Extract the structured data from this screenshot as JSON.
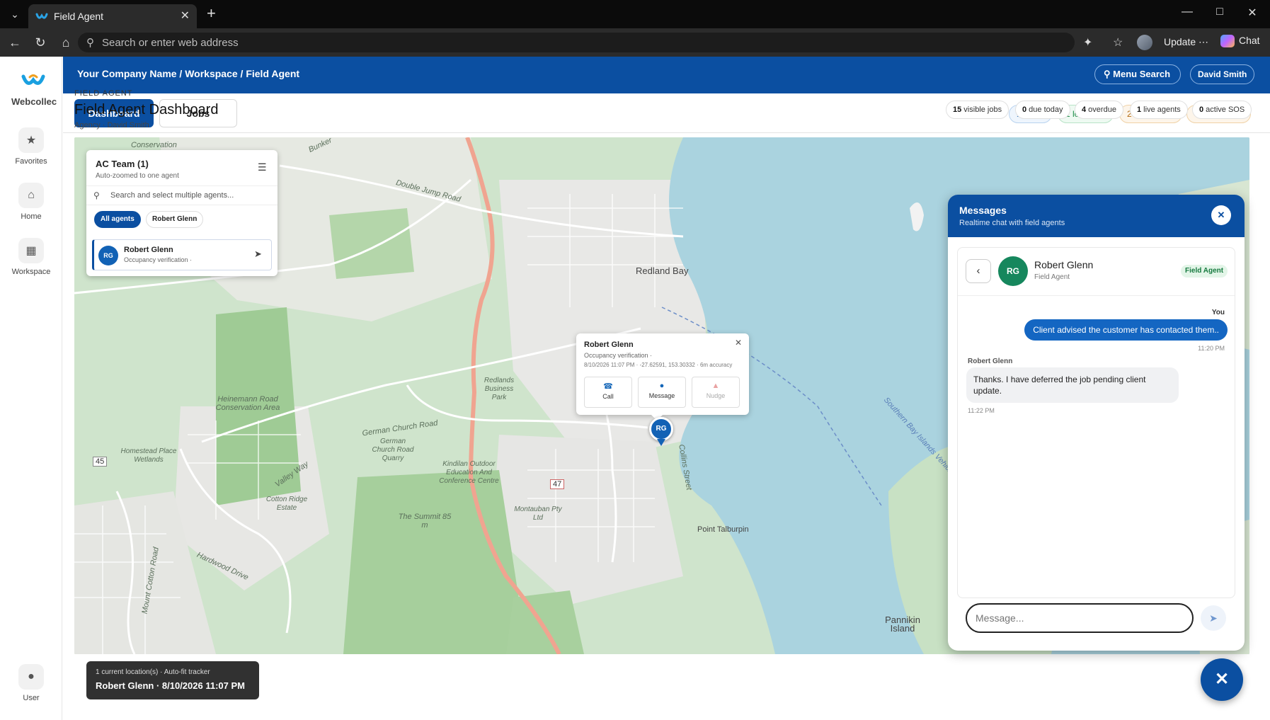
{
  "browser": {
    "tab_title": "Field Agent",
    "address_placeholder": "Search or enter web address",
    "update_label": "Update",
    "chat_label": "Chat"
  },
  "rail": {
    "brand": "Webcollec",
    "items": [
      {
        "label": "Favorites",
        "icon": "star-icon"
      },
      {
        "label": "Home",
        "icon": "home-icon"
      },
      {
        "label": "Workspace",
        "icon": "grid-icon"
      },
      {
        "label": "User",
        "icon": "user-icon"
      }
    ]
  },
  "topbar": {
    "breadcrumb": "Your Company Name / Workspace / Field Agent",
    "menu_search": "Menu Search",
    "user": "David Smith"
  },
  "tabs": {
    "dashboard": "Dashboard",
    "jobs": "Jobs"
  },
  "stats": [
    {
      "label": "15 jobs",
      "color": "#1466b8"
    },
    {
      "label": "1 locations",
      "color": "#1a8a45"
    },
    {
      "label": "20 SOS logs",
      "color": "#b36a12"
    },
    {
      "label": "744 activities",
      "color": "#b36a12"
    }
  ],
  "header": {
    "kicker": "FIELD AGENT",
    "title": "Field Agent Dashboard",
    "subtitle": "Agency · David Smith"
  },
  "kpis": [
    {
      "value": "15",
      "label": " visible jobs"
    },
    {
      "value": "0",
      "label": " due today"
    },
    {
      "value": "4",
      "label": " overdue"
    },
    {
      "value": "1",
      "label": " live agents"
    },
    {
      "value": "0",
      "label": " active SOS"
    }
  ],
  "map": {
    "labels": {
      "conservation": "Conservation",
      "bunker": "Bunker",
      "double_jump": "Double Jump Road",
      "redland_bay": "Redland Bay",
      "heinemann": "Heinemann Road Conservation Area",
      "redlands_bp": "Redlands Business Park",
      "german_church": "German Church Road",
      "quarry": "German Church Road Quarry",
      "kindilan": "Kindilan Outdoor Education And Conference Centre",
      "homestead": "Homestead Place Wetlands",
      "cotton": "Cotton Ridge Estate",
      "valley_way": "Valley Way",
      "summit": "The Summit 85 m",
      "montauban": "Montauban Pty Ltd",
      "collins": "Collins Street",
      "point_talburpin": "Point Talburpin",
      "southern_bay": "Southern Bay Islands Vehicle F",
      "pannikin": "Pannikin Island",
      "mount_cotton": "Mount Cotton Road",
      "hardwood": "Hardwood Drive",
      "route_47": "47",
      "route_45": "45"
    }
  },
  "agent_panel": {
    "title": "AC Team (1)",
    "subtitle": "Auto-zoomed to one agent",
    "search_placeholder": "Search and select multiple agents...",
    "chip_all": "All agents",
    "chip_agent": "Robert Glenn",
    "agent": {
      "initials": "RG",
      "name": "Robert Glenn",
      "desc": "Occupancy verification ·"
    }
  },
  "popup": {
    "name": "Robert Glenn",
    "job": "Occupancy verification ·",
    "meta": "8/10/2026 11:07 PM · -27.62591, 153.30332 · 6m accuracy",
    "call": "Call",
    "message": "Message",
    "nudge": "Nudge"
  },
  "pin": {
    "initials": "RG"
  },
  "tracker": {
    "line1": "1 current location(s) · Auto-fit tracker",
    "line2": "Robert Glenn · 8/10/2026 11:07 PM"
  },
  "messages": {
    "title": "Messages",
    "subtitle": "Realtime chat with field agents",
    "contact": {
      "initials": "RG",
      "name": "Robert Glenn",
      "role": "Field Agent",
      "badge": "Field Agent"
    },
    "thread": [
      {
        "sender": "You",
        "text": "Client advised the customer has contacted them..",
        "time": "11:20 PM"
      },
      {
        "sender": "Robert Glenn",
        "text": "Thanks. I have deferred the job pending client update.",
        "time": "11:22 PM"
      }
    ],
    "input_placeholder": "Message..."
  }
}
